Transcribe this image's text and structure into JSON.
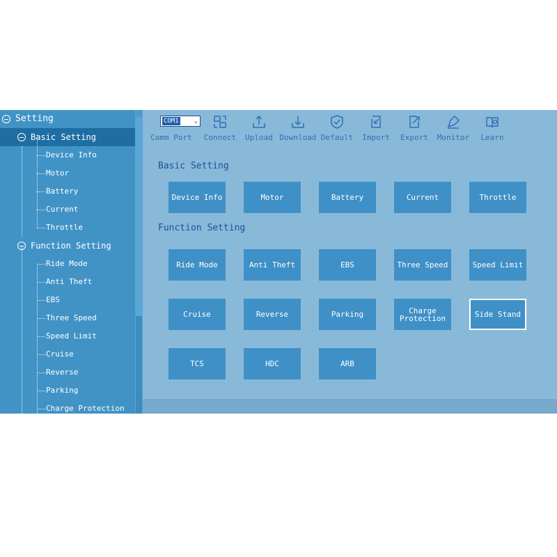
{
  "sidebar": {
    "items": [
      {
        "label": "Setting",
        "level": 0,
        "toggle": true,
        "selected": false
      },
      {
        "label": "Basic Setting",
        "level": 1,
        "toggle": true,
        "selected": true
      },
      {
        "label": "Device Info",
        "level": 2
      },
      {
        "label": "Motor",
        "level": 2
      },
      {
        "label": "Battery",
        "level": 2
      },
      {
        "label": "Current",
        "level": 2
      },
      {
        "label": "Throttle",
        "level": 2
      },
      {
        "label": "Function Setting",
        "level": 1,
        "toggle": true,
        "selected": false
      },
      {
        "label": "Ride Mode",
        "level": 2
      },
      {
        "label": "Anti Theft",
        "level": 2
      },
      {
        "label": "EBS",
        "level": 2
      },
      {
        "label": "Three Speed",
        "level": 2
      },
      {
        "label": "Speed Limit",
        "level": 2
      },
      {
        "label": "Cruise",
        "level": 2
      },
      {
        "label": "Reverse",
        "level": 2
      },
      {
        "label": "Parking",
        "level": 2
      },
      {
        "label": "Charge Protection",
        "level": 2
      }
    ]
  },
  "toolbar": {
    "comport": {
      "value": "COM1",
      "label": "Comm Port"
    },
    "tools": [
      {
        "label": "Connect",
        "icon": "connect-icon"
      },
      {
        "label": "Upload",
        "icon": "upload-icon"
      },
      {
        "label": "Download",
        "icon": "download-icon"
      },
      {
        "label": "Default",
        "icon": "shield-check-icon"
      },
      {
        "label": "Import",
        "icon": "import-icon"
      },
      {
        "label": "Export",
        "icon": "export-icon"
      },
      {
        "label": "Monitor",
        "icon": "monitor-icon"
      },
      {
        "label": "Learn",
        "icon": "book-icon"
      }
    ]
  },
  "main": {
    "basic": {
      "title": "Basic Setting",
      "buttons": [
        "Device Info",
        "Motor",
        "Battery",
        "Current",
        "Throttle"
      ]
    },
    "function": {
      "title": "Function Setting",
      "buttons": [
        "Ride Mode",
        "Anti Theft",
        "EBS",
        "Three Speed",
        "Speed Limit",
        "Cruise",
        "Reverse",
        "Parking",
        "Charge\nProtection",
        "Side Stand",
        "TCS",
        "HDC",
        "ARB"
      ],
      "selected": "Side Stand"
    }
  },
  "colors": {
    "sidebar_bg": "#4193c6",
    "selected_item": "#1f6ea3",
    "content_bg": "#88b9d9",
    "button_bg": "#3f90c7",
    "accent_text": "#2f6fb5"
  }
}
